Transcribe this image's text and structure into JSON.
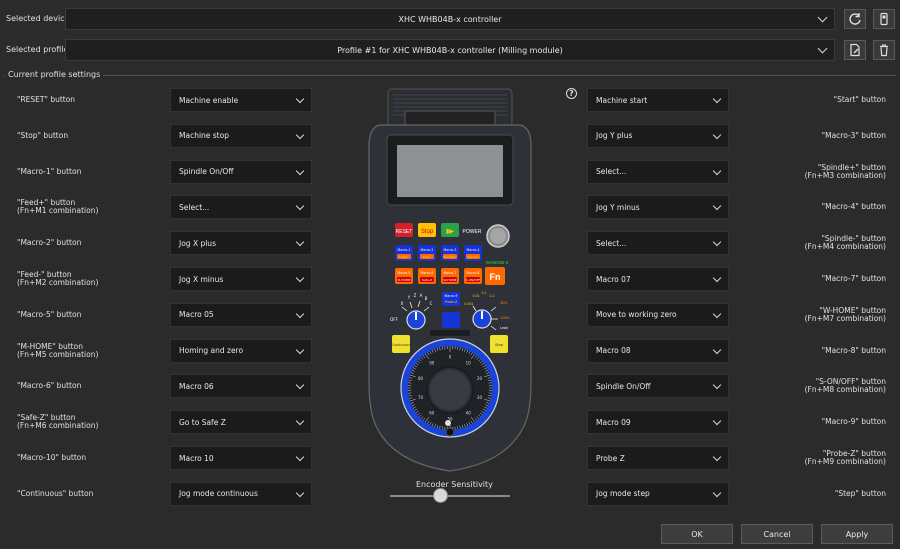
{
  "header": {
    "device_label": "Selected device",
    "device_value": "XHC WHB04B-x controller",
    "profile_label": "Selected profile",
    "profile_value": "Profile #1 for XHC WHB04B-x controller (Milling module)"
  },
  "group_title": "Current profile settings",
  "help_glyph": "?",
  "left_rows": [
    {
      "label": "\"RESET\" button",
      "sub": "",
      "value": "Machine enable"
    },
    {
      "label": "\"Stop\" button",
      "sub": "",
      "value": "Machine stop"
    },
    {
      "label": "\"Macro-1\" button",
      "sub": "",
      "value": "Spindle On/Off"
    },
    {
      "label": "\"Feed+\" button",
      "sub": "(Fn+M1 combination)",
      "value": "Select..."
    },
    {
      "label": "\"Macro-2\" button",
      "sub": "",
      "value": "Jog X plus"
    },
    {
      "label": "\"Feed-\" button",
      "sub": "(Fn+M2 combination)",
      "value": "Jog X minus"
    },
    {
      "label": "\"Macro-5\" button",
      "sub": "",
      "value": "Macro 05"
    },
    {
      "label": "\"M-HOME\" button",
      "sub": "(Fn+M5 combination)",
      "value": "Homing and zero"
    },
    {
      "label": "\"Macro-6\" button",
      "sub": "",
      "value": "Macro 06"
    },
    {
      "label": "\"Safe-Z\" button",
      "sub": "(Fn+M6 combination)",
      "value": "Go to Safe Z"
    },
    {
      "label": "\"Macro-10\" button",
      "sub": "",
      "value": "Macro 10"
    },
    {
      "label": "\"Continuous\" button",
      "sub": "",
      "value": "Jog mode continuous"
    }
  ],
  "right_rows": [
    {
      "label": "\"Start\" button",
      "sub": "",
      "value": "Machine start"
    },
    {
      "label": "\"Macro-3\" button",
      "sub": "",
      "value": "Jog Y plus"
    },
    {
      "label": "\"Spindle+\" button",
      "sub": "(Fn+M3 combination)",
      "value": "Select..."
    },
    {
      "label": "\"Macro-4\" button",
      "sub": "",
      "value": "Jog Y minus"
    },
    {
      "label": "\"Spindle-\" button",
      "sub": "(Fn+M4 combination)",
      "value": "Select..."
    },
    {
      "label": "\"Macro-7\" button",
      "sub": "",
      "value": "Macro 07"
    },
    {
      "label": "\"W-HOME\" button",
      "sub": "(Fn+M7 combination)",
      "value": "Move to working zero"
    },
    {
      "label": "\"Macro-8\" button",
      "sub": "",
      "value": "Macro 08"
    },
    {
      "label": "\"S-ON/OFF\" button",
      "sub": "(Fn+M8 combination)",
      "value": "Spindle On/Off"
    },
    {
      "label": "\"Macro-9\" button",
      "sub": "",
      "value": "Macro 09"
    },
    {
      "label": "\"Probe-Z\" button",
      "sub": "(Fn+M9 combination)",
      "value": "Probe Z"
    },
    {
      "label": "\"Step\" button",
      "sub": "",
      "value": "Jog mode step"
    }
  ],
  "pendant": {
    "reset": "RESET",
    "stop": "Stop",
    "power": "POWER",
    "model": "WHB04B-6",
    "fn": "Fn",
    "macros": [
      {
        "top": "Macro-1",
        "bot": "Feed+"
      },
      {
        "top": "Macro-2",
        "bot": "Feed-"
      },
      {
        "top": "Macro-3",
        "bot": "Spindle+"
      },
      {
        "top": "Macro-4",
        "bot": "Spindle-"
      },
      {
        "top": "Macro-5",
        "bot": "M-HOME"
      },
      {
        "top": "Macro-6",
        "bot": "Safe-Z"
      },
      {
        "top": "Macro-7",
        "bot": "W-HOME"
      },
      {
        "top": "Macro-8",
        "bot": "S-ON/OFF"
      }
    ],
    "macro9_top": "Macro-9",
    "macro9_bot": "Probe-Z",
    "axis_off": "OFF",
    "axis_labels": [
      "X",
      "Y",
      "Z",
      "A",
      "B",
      "C"
    ],
    "step_labels": [
      "0.001",
      "0.01",
      "0.1",
      "1.0",
      "60%",
      "100%",
      "Lead"
    ],
    "continuous": "Continuous",
    "step": "Step",
    "wheel_numbers": [
      "0",
      "10",
      "20",
      "30",
      "40",
      "50",
      "60",
      "70",
      "80",
      "90"
    ]
  },
  "slider_label": "Encoder Sensitivity",
  "buttons": {
    "ok": "OK",
    "cancel": "Cancel",
    "apply": "Apply"
  },
  "colors": {
    "background": "#2b2b2b",
    "dropdown": "#1b1b1b",
    "pendant_body": "#2e3238",
    "wheel_ring": "#1a43d8"
  }
}
